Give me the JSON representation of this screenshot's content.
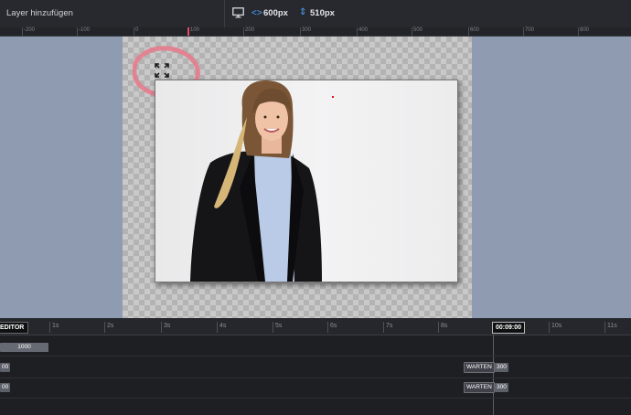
{
  "toolbar": {
    "title": "Layer hinzufügen",
    "device_icon": "monitor-icon",
    "width_icon": "arrows-horizontal-icon",
    "width_value": "600px",
    "height_icon": "arrows-vertical-icon",
    "height_value": "510px"
  },
  "ruler": {
    "ticks": [
      "-200",
      "-100",
      "0",
      "100",
      "200",
      "300",
      "400",
      "500",
      "600",
      "700",
      "800"
    ]
  },
  "canvas": {
    "fullscreen_icon": "fullscreen-expand-icon",
    "annotation": "red-circle-highlight"
  },
  "timeline": {
    "editor_label": "EDITOR",
    "seconds": [
      "1s",
      "2s",
      "3s",
      "4s",
      "5s",
      "6s",
      "7s",
      "8s",
      "10s",
      "11s"
    ],
    "current_time": "00:09:00",
    "rows": [
      {
        "start_value": "1000"
      },
      {
        "start_value": "00",
        "wait_label": "WARTEN",
        "wait_value": "300"
      },
      {
        "start_value": "00",
        "wait_label": "WARTEN",
        "wait_value": "300"
      }
    ]
  }
}
